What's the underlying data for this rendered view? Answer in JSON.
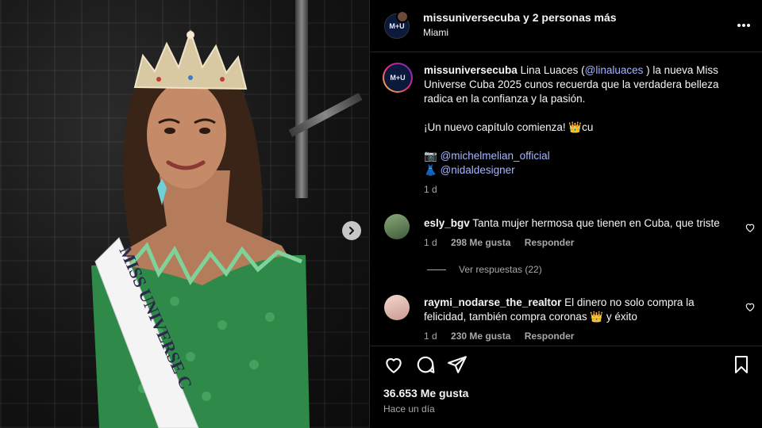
{
  "post": {
    "header": {
      "title": "missuniversecuba y 2 personas más",
      "location": "Miami",
      "avatar_text": "M+U",
      "more_icon": "more-horizontal-icon"
    },
    "caption": {
      "username": "missuniversecuba",
      "text_before_mention": " Lina Luaces (",
      "mention": "@linaluaces",
      "text_after_mention": " ) la nueva Miss Universe Cuba 2025 cunos recuerda que la verdadera belleza radica en la confianza y la pasión.",
      "line2": "¡Un nuevo capítulo comienza! 👑cu",
      "credit_photo_emoji": "📷",
      "credit_photo": "@michelmelian_official",
      "credit_dress_emoji": "👗",
      "credit_dress": "@nidaldesigner",
      "time": "1 d"
    },
    "comments": [
      {
        "username": "esly_bgv",
        "text": " Tanta mujer hermosa que tienen en Cuba, que triste",
        "time": "1 d",
        "likes": "298 Me gusta",
        "reply": "Responder"
      },
      {
        "username": "raymi_nodarse_the_realtor",
        "text": " El dinero no solo compra la felicidad, también compra coronas 👑 y éxito",
        "time": "1 d",
        "likes": "230 Me gusta",
        "reply": "Responder"
      }
    ],
    "view_replies": "Ver respuestas (22)",
    "likes_count": "36.653 Me gusta",
    "posted_ago": "Hace un día"
  },
  "photo": {
    "sash_text": "MISS UNIVERSE C",
    "dress_color": "#2f8a4a",
    "background_color": "#141414"
  },
  "colors": {
    "mention_link": "#a4b6ff",
    "muted": "#a8a8a8",
    "divider": "#262626"
  }
}
